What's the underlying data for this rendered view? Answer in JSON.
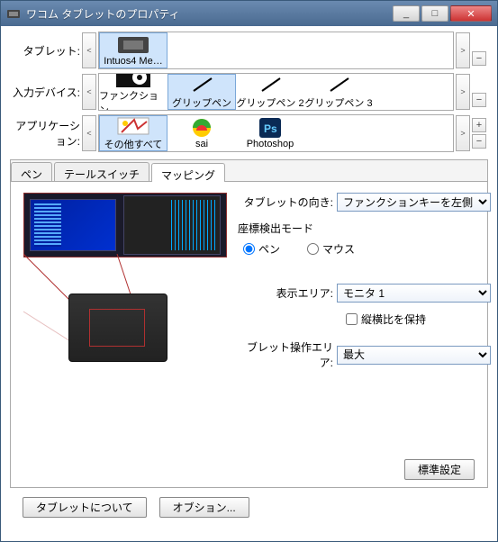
{
  "window": {
    "title": "ワコム タブレットのプロパティ",
    "min": "_",
    "max": "□",
    "close": "✕"
  },
  "scroll": {
    "left": "<",
    "right": ">",
    "plus": "+",
    "minus": "−"
  },
  "labels": {
    "tablet": "タブレット",
    "input_device": "入力デバイス",
    "application": "アプリケーション"
  },
  "tablet_items": [
    {
      "label": "Intuos4 Me…"
    }
  ],
  "tool_items": [
    {
      "label": "ファンクション"
    },
    {
      "label": "グリップペン"
    },
    {
      "label": "グリップペン 2"
    },
    {
      "label": "グリップペン 3"
    }
  ],
  "app_items": [
    {
      "label": "その他すべて"
    },
    {
      "label": "sai"
    },
    {
      "label": "Photoshop"
    }
  ],
  "tabs": {
    "pen": "ペン",
    "tail": "テールスイッチ",
    "mapping": "マッピング"
  },
  "mapping": {
    "orientation_label": "タブレットの向き",
    "orientation_value": "ファンクションキーを左側",
    "mode_title": "座標検出モード",
    "mode_pen": "ペン",
    "mode_mouse": "マウス",
    "display_label": "表示エリア",
    "display_value": "モニタ 1",
    "aspect_label": "縦横比を保持",
    "tablet_area_label": "ブレット操作エリア",
    "tablet_area_value": "最大",
    "default_btn": "標準設定"
  },
  "footer": {
    "about": "タブレットについて",
    "options": "オブション..."
  }
}
